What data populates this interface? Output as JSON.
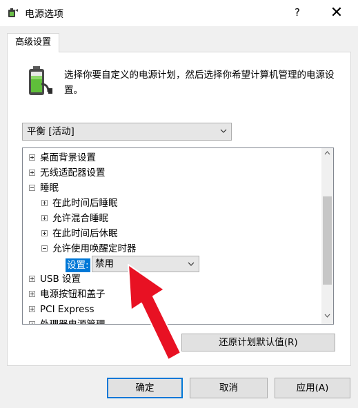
{
  "window": {
    "title": "电源选项",
    "help_label": "?",
    "close_label": "✕"
  },
  "tab": {
    "label": "高级设置"
  },
  "description": "选择你要自定义的电源计划，然后选择你希望计算机管理的电源设置。",
  "plan_select": {
    "value": "平衡 [活动]"
  },
  "tree": {
    "items": [
      {
        "label": "桌面背景设置",
        "expander": "plus"
      },
      {
        "label": "无线适配器设置",
        "expander": "plus"
      },
      {
        "label": "睡眠",
        "expander": "minus"
      },
      {
        "label": "在此时间后睡眠",
        "expander": "plus"
      },
      {
        "label": "允许混合睡眠",
        "expander": "plus"
      },
      {
        "label": "在此时间后休眠",
        "expander": "plus"
      },
      {
        "label": "允许使用唤醒定时器",
        "expander": "minus"
      },
      {
        "label": "USB 设置",
        "expander": "plus"
      },
      {
        "label": "电源按钮和盖子",
        "expander": "plus"
      },
      {
        "label": "PCI Express",
        "expander": "plus"
      },
      {
        "label": "处理器电源管理",
        "expander": "plus"
      }
    ],
    "setting": {
      "label": "设置:",
      "value": "禁用"
    }
  },
  "buttons": {
    "restore": "还原计划默认值(R)",
    "ok": "确定",
    "cancel": "取消",
    "apply": "应用(A)"
  },
  "colors": {
    "accent": "#0078d7",
    "annotation_arrow": "#e81123"
  }
}
